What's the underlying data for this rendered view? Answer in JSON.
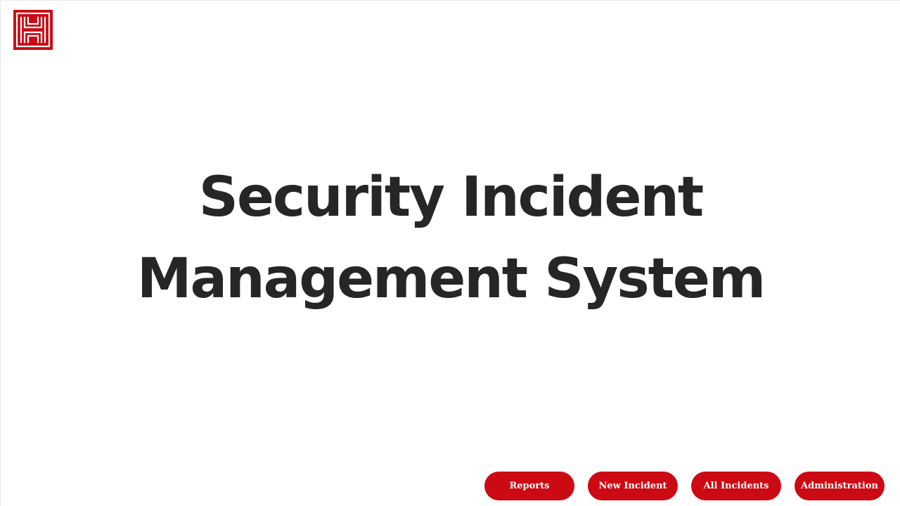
{
  "brand": {
    "logo_icon": "maze-h-logo-icon",
    "color": "#cc0a14"
  },
  "main": {
    "title": "Security Incident Management System"
  },
  "nav": {
    "buttons": [
      {
        "label": "Reports"
      },
      {
        "label": "New Incident"
      },
      {
        "label": "All Incidents"
      },
      {
        "label": "Administration"
      }
    ]
  },
  "colors": {
    "accent": "#cc0a14",
    "title_text": "#262626",
    "background": "#ffffff"
  }
}
